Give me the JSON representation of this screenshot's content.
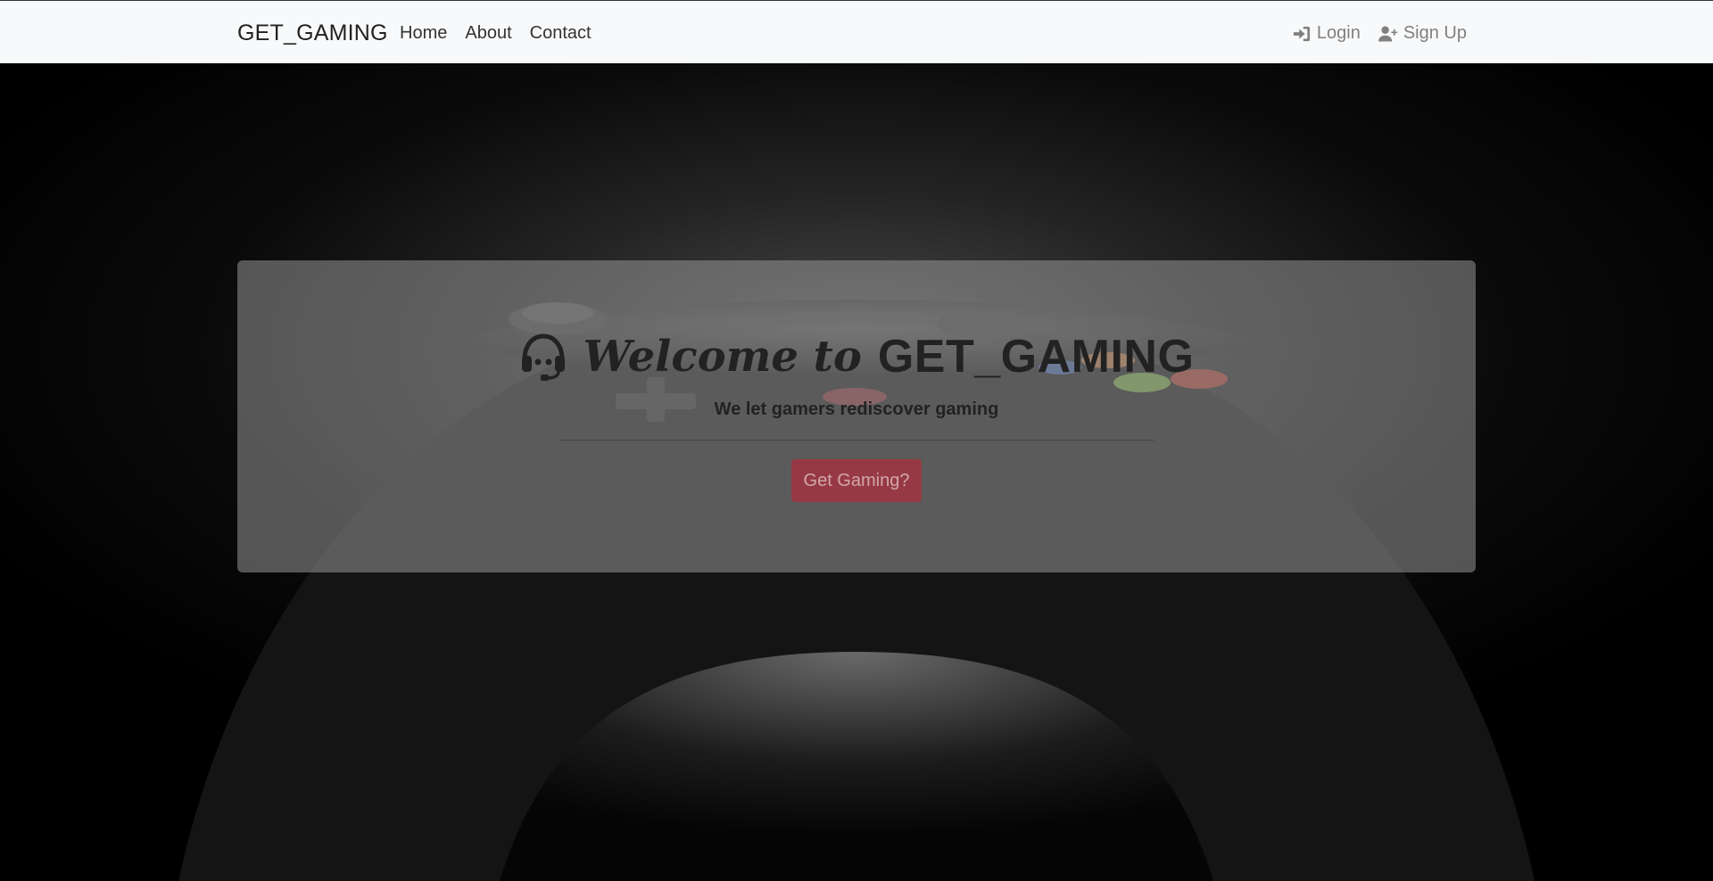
{
  "nav": {
    "brand": "GET_GAMING",
    "links": [
      "Home",
      "About",
      "Contact"
    ],
    "auth": {
      "login": "Login",
      "signup": "Sign Up"
    }
  },
  "hero": {
    "welcome_script": "Welcome to",
    "welcome_brand": "GET_GAMING",
    "tagline": "We let gamers rediscover gaming",
    "cta_label": "Get Gaming?"
  },
  "icons": {
    "login": "sign-in-icon",
    "signup": "user-plus-icon",
    "headset": "headset-icon"
  },
  "colors": {
    "navbar_bg": "#f8f9fa",
    "cta": "#c81e32",
    "text_dark": "#222222",
    "auth_text": "#808080"
  }
}
